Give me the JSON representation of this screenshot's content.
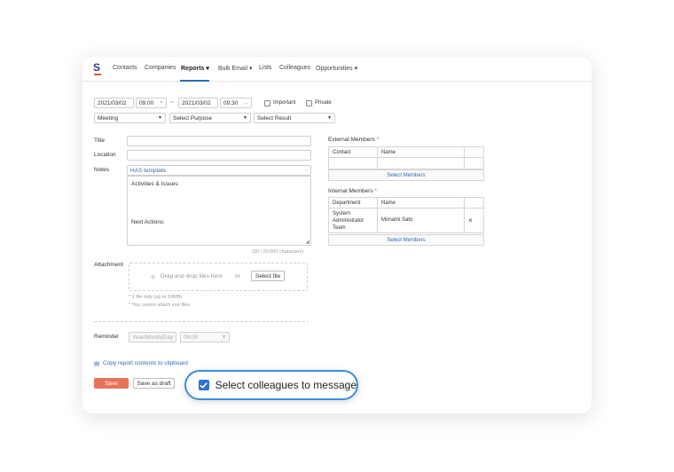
{
  "nav": {
    "logo_letter": "S",
    "items": [
      {
        "label": "Contacts"
      },
      {
        "label": "Companies"
      },
      {
        "label": "Reports ▾"
      },
      {
        "label": "Bulk Email ▾"
      },
      {
        "label": "Lists"
      },
      {
        "label": "Colleagues"
      },
      {
        "label": "Opportunities ▾"
      }
    ],
    "active": "Reports"
  },
  "form": {
    "start_date": "2021/03/02",
    "start_time": "09:00",
    "range_sep": "~",
    "end_date": "2021/03/02",
    "end_time": "09:30",
    "important_label": "Important",
    "private_label": "Private",
    "type_select": "Meeting",
    "purpose_select": "Select Purpose",
    "result_select": "Select Result",
    "title_label": "Title",
    "location_label": "Location",
    "notes_label": "Notes",
    "template_select": "HAS template",
    "notes_line1": "Activities & Issues:",
    "notes_line2": "Next Actions:",
    "char_count": "(30 / 20,000 characters)",
    "attachment_label": "Attachment",
    "drop_text": "Drag and drop files here",
    "or_text": "or",
    "select_file": "Select file",
    "file_note1": "* 1 file only (up to 10MB)",
    "file_note2": "* You cannot attach exe files.",
    "reminder_label": "Reminder",
    "reminder_date_placeholder": "Year/Month/Day",
    "reminder_time": "09:00",
    "copy_link": "Copy report contents to clipboard",
    "save": "Save",
    "save_draft": "Save as draft"
  },
  "external": {
    "heading": "External Members",
    "required": "*",
    "columns": [
      "Contact",
      "Name"
    ],
    "select_button": "Select Members"
  },
  "internal": {
    "heading": "Internal Members",
    "required": "*",
    "columns": [
      "Department",
      "Name"
    ],
    "row": {
      "department_l1": "System",
      "department_l2": "Administrator",
      "department_l3": "Team",
      "name": "Monami Sato",
      "remove": "×"
    },
    "select_button": "Select Members"
  },
  "callout": {
    "label": "Select colleagues to message",
    "checked": true
  },
  "colors": {
    "accent": "#2b6cb5",
    "save": "#e8735a",
    "callout_border": "#3c8ce0",
    "checkbox": "#2f6fd6"
  }
}
